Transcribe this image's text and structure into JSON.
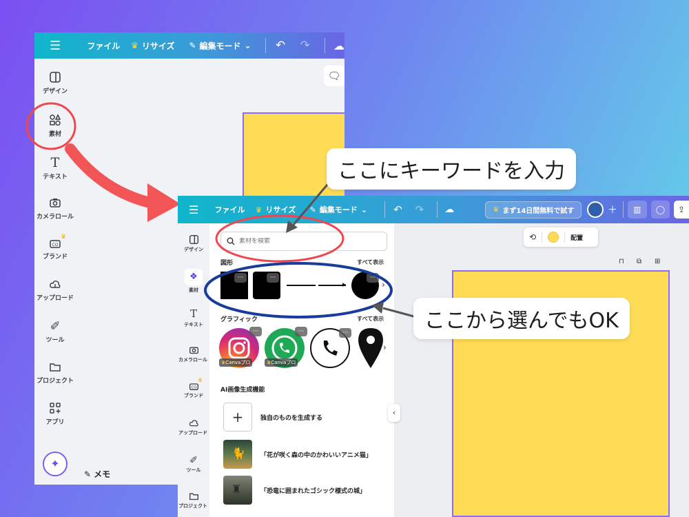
{
  "back_window": {
    "topbar": {
      "file": "ファイル",
      "resize": "リサイズ",
      "edit_mode": "編集モード"
    },
    "rail": [
      {
        "icon": "layout-icon",
        "label": "デザイン"
      },
      {
        "icon": "shapes-icon",
        "label": "素材"
      },
      {
        "icon": "text-icon",
        "label": "テキスト"
      },
      {
        "icon": "camera-icon",
        "label": "カメラロール"
      },
      {
        "icon": "brand-icon",
        "label": "ブランド"
      },
      {
        "icon": "upload-cloud-icon",
        "label": "アップロード"
      },
      {
        "icon": "tools-icon",
        "label": "ツール"
      },
      {
        "icon": "folder-icon",
        "label": "プロジェクト"
      },
      {
        "icon": "apps-icon",
        "label": "アプリ"
      }
    ],
    "memo": "メモ"
  },
  "front_window": {
    "topbar": {
      "file": "ファイル",
      "resize": "リサイズ",
      "edit_mode": "編集モード",
      "trial_button": "まず14日間無料で試す"
    },
    "rail": [
      {
        "icon": "layout-icon",
        "label": "デザイン"
      },
      {
        "icon": "shapes-icon",
        "label": "素材"
      },
      {
        "icon": "text-icon",
        "label": "テキスト"
      },
      {
        "icon": "camera-icon",
        "label": "カメラロール"
      },
      {
        "icon": "brand-icon",
        "label": "ブランド"
      },
      {
        "icon": "upload-cloud-icon",
        "label": "アップロード"
      },
      {
        "icon": "tools-icon",
        "label": "ツール"
      },
      {
        "icon": "folder-icon",
        "label": "プロジェクト"
      }
    ],
    "panel": {
      "search_placeholder": "素材を検索",
      "shapes_header": "図形",
      "see_all_1": "すべて表示",
      "graphics_header": "グラフィック",
      "see_all_2": "すべて表示",
      "canva_pro_1": "Canvaプロ",
      "canva_pro_2": "Canvaプロ",
      "ai_header": "AI画像生成機能",
      "ai_generate": "独自のものを生成する",
      "ai_prompt_1": "「花が咲く森の中のかわいいアニメ猫」",
      "ai_prompt_2": "「恐竜に囲まれたゴシック様式の城」"
    },
    "context_toolbar": {
      "arrange": "配置"
    }
  },
  "callouts": {
    "keyword": "ここにキーワードを入力",
    "choose": "ここから選んでもOK"
  },
  "colors": {
    "page_yellow": "#ffdc55",
    "annotation_red": "#f0474f",
    "annotation_blue": "#173c9a",
    "arrow_red": "#f25555"
  }
}
